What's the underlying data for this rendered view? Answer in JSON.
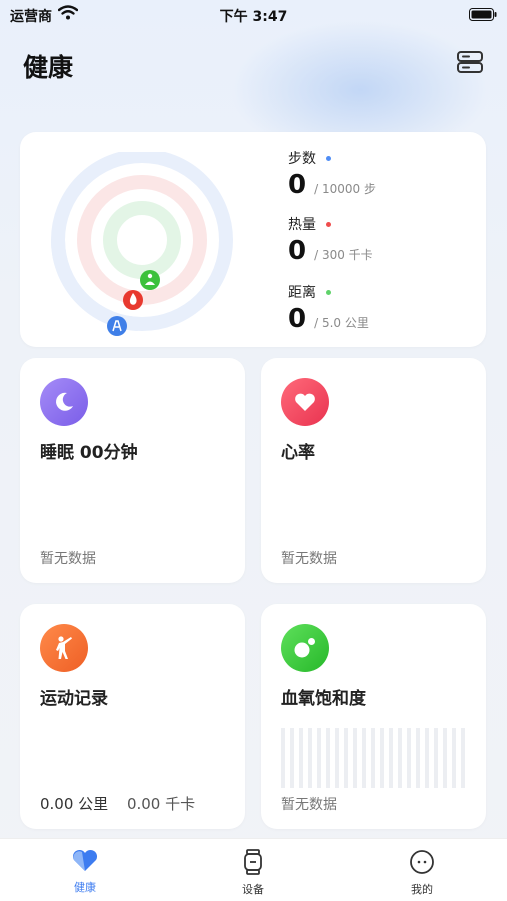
{
  "status_bar": {
    "carrier": "运营商",
    "time": "下午 3:47"
  },
  "header": {
    "title": "健康"
  },
  "activity": {
    "steps": {
      "label": "步数",
      "value": "0",
      "target": "/ 10000 步",
      "color": "#4f8df5"
    },
    "calories": {
      "label": "热量",
      "value": "0",
      "target": "/ 300 千卡",
      "color": "#ef4c4c"
    },
    "distance": {
      "label": "距离",
      "value": "0",
      "target": "/ 5.0 公里",
      "color": "#5fd26a"
    }
  },
  "cards": {
    "sleep": {
      "title": "睡眠 00分钟",
      "subtitle": "暂无数据",
      "color": "#8a6df2"
    },
    "heart": {
      "title": "心率",
      "subtitle": "暂无数据",
      "color": "#f04a5c"
    },
    "exercise": {
      "title": "运动记录",
      "distance": "0.00 公里",
      "calories": "0.00 千卡",
      "color": "#f2723a"
    },
    "spo2": {
      "title": "血氧饱和度",
      "subtitle": "暂无数据",
      "color": "#3fcd3c"
    }
  },
  "tabbar": {
    "health": "健康",
    "device": "设备",
    "mine": "我的",
    "active_color": "#3d7cf0"
  }
}
